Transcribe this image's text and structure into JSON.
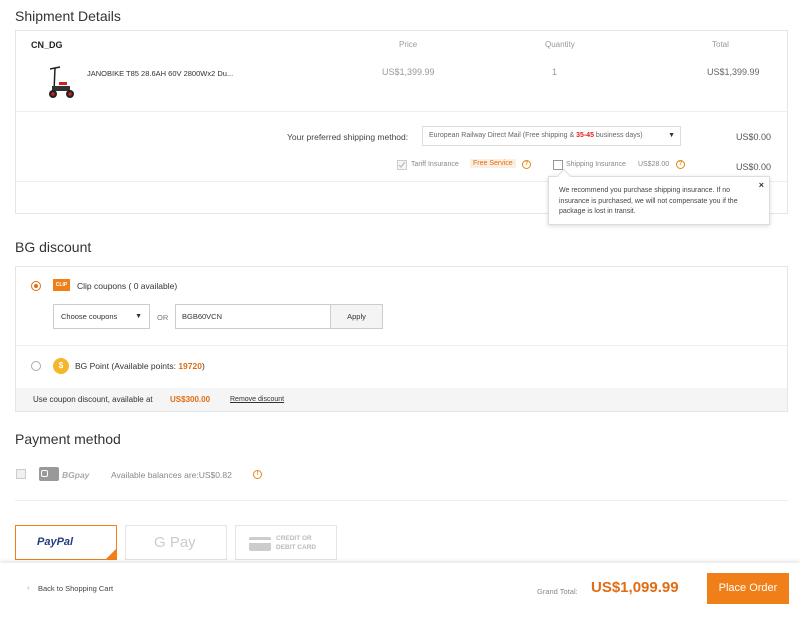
{
  "shipment": {
    "title": "Shipment Details",
    "warehouse": "CN_DG",
    "columns": {
      "price": "Price",
      "quantity": "Quantity",
      "total": "Total"
    },
    "product": {
      "name": "JANOBIKE T85 28.6AH 60V 2800Wx2 Du...",
      "price": "US$1,399.99",
      "quantity": "1",
      "total": "US$1,399.99"
    },
    "shipping_label": "Your preferred shipping method:",
    "shipping_method_prefix": "European Railway Direct Mail (Free shipping & ",
    "shipping_days": "35-45",
    "shipping_method_suffix": " business days)",
    "shipping_cost": "US$0.00",
    "tariff_label": "Tariff Insurance",
    "free_service": "Free Service",
    "shipping_insurance_label": "Shipping Insurance",
    "shipping_insurance_price": "US$28.00",
    "insurance_cost": "US$0.00",
    "tooltip_text": "We recommend you purchase shipping insurance. If no insurance is purchased, we will not compensate you if the package is lost in transit.",
    "tooltip_close": "×"
  },
  "discount": {
    "title": "BG discount",
    "clip_coupons_label": "Clip coupons ( 0 available)",
    "clip_icon_text": "CLIP",
    "choose_coupons": "Choose coupons",
    "or": "OR",
    "coupon_code": "BGB60VCN",
    "apply": "Apply",
    "bg_point_prefix": "BG Point (Available points: ",
    "bg_points": "19720",
    "bg_point_suffix": ")",
    "coin_symbol": "$",
    "footer_prefix": "Use coupon discount, available at ",
    "footer_amount": "US$300.00",
    "remove_discount": "Remove discount"
  },
  "payment": {
    "title": "Payment method",
    "bgpay_label": "BGpay",
    "balance": "Available balances are:US$0.82",
    "paypal": "PayPal",
    "gpay": "G Pay",
    "card_line1": "CREDIT OR",
    "card_line2": "DEBIT CARD"
  },
  "footer": {
    "back": "Back to Shopping Cart",
    "grand_total_label": "Grand Total:",
    "grand_total": "US$1,099.99",
    "place_order": "Place Order"
  },
  "colors": {
    "accent": "#f07f1a",
    "paypal_dark": "#253b80",
    "paypal_light": "#179bd7",
    "days_red": "#e02020"
  }
}
